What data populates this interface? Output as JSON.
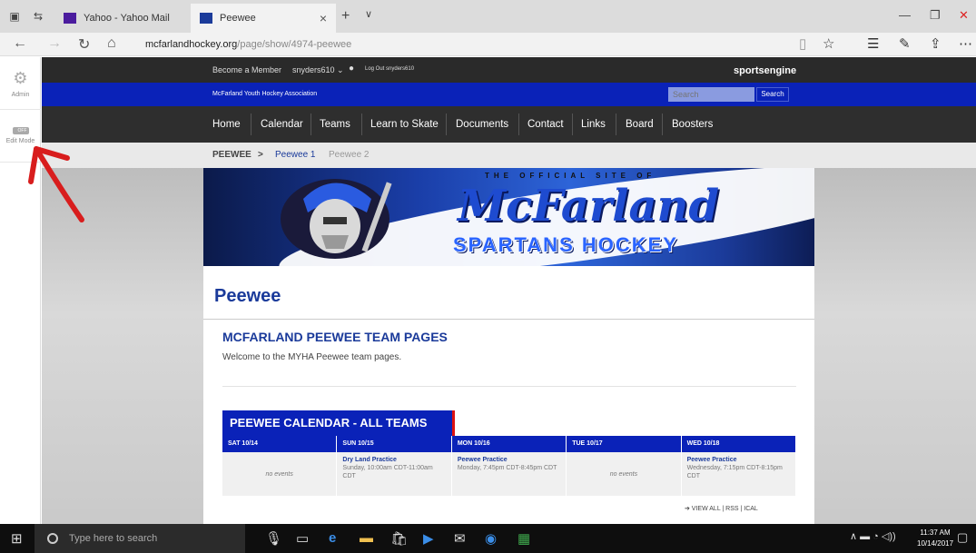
{
  "browser": {
    "tabs": [
      {
        "label": "Yahoo - Yahoo Mail"
      },
      {
        "label": "Peewee"
      }
    ],
    "url_domain": "mcfarlandhockey.org",
    "url_path": "/page/show/4974-peewee"
  },
  "admin": {
    "admin_label": "Admin",
    "edit_mode_label": "Edit Mode",
    "toggle_state": "OFF"
  },
  "topbar": {
    "become_member": "Become a Member",
    "user": "snyders610 ⌄",
    "logout": "Log Out snyders610",
    "brand": "sportsengine"
  },
  "orgbar": {
    "org_name": "McFarland Youth Hockey Association",
    "search_placeholder": "Search",
    "search_button": "Search"
  },
  "nav": {
    "items": [
      "Home",
      "Calendar",
      "Teams",
      "Learn to Skate",
      "Documents",
      "Contact",
      "Links",
      "Board",
      "Boosters"
    ]
  },
  "breadcrumb": {
    "root": "PEEWEE",
    "sep": ">",
    "active": "Peewee 1",
    "other": "Peewee 2"
  },
  "banner": {
    "tagline": "THE OFFICIAL SITE OF",
    "script": "McFarland",
    "sub": "SPARTANS HOCKEY"
  },
  "content": {
    "page_title": "Peewee",
    "section_title": "MCFARLAND PEEWEE TEAM PAGES",
    "section_text": "Welcome to the MYHA Peewee team pages.",
    "calendar_title": "PEEWEE CALENDAR - ALL TEAMS",
    "days": [
      "SAT 10/14",
      "SUN 10/15",
      "MON 10/16",
      "TUE 10/17",
      "WED 10/18"
    ],
    "events": [
      {
        "title": "",
        "detail": "no events"
      },
      {
        "title": "Dry Land Practice",
        "detail": "Sunday, 10:00am CDT-11:00am CDT"
      },
      {
        "title": "Peewee Practice",
        "detail": "Monday, 7:45pm CDT-8:45pm CDT"
      },
      {
        "title": "",
        "detail": "no events"
      },
      {
        "title": "Peewee Practice",
        "detail": "Wednesday, 7:15pm CDT-8:15pm CDT"
      }
    ],
    "footer_links": "➔ VIEW ALL | RSS | ICAL"
  },
  "taskbar": {
    "search_placeholder": "Type here to search",
    "time": "11:37 AM",
    "date": "10/14/2017"
  }
}
